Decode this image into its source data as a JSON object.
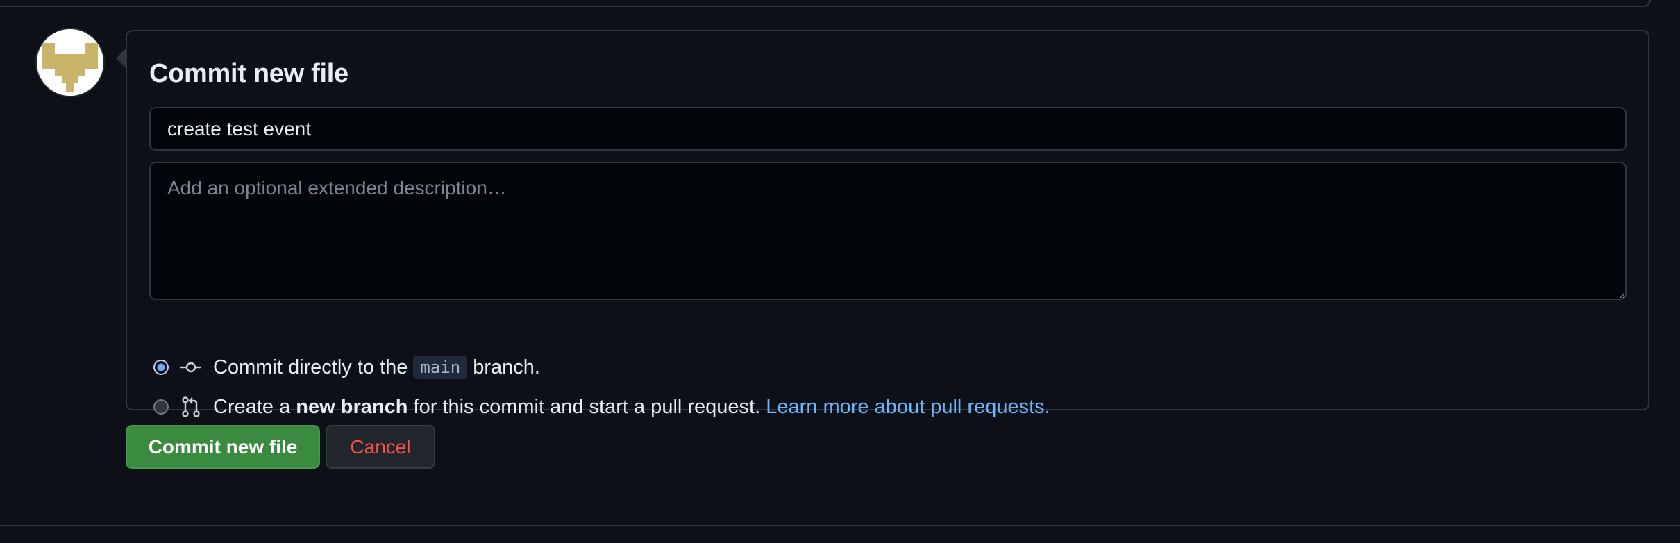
{
  "commit": {
    "title": "Commit new file",
    "summary_value": "create test event",
    "description_placeholder": "Add an optional extended description…",
    "option_direct": {
      "prefix": "Commit directly to the",
      "branch": "main",
      "suffix": "branch.",
      "selected": true,
      "icon": "git-commit-icon"
    },
    "option_new_branch": {
      "prefix": "Create a",
      "bold": "new branch",
      "suffix": "for this commit and start a pull request.",
      "link": "Learn more about pull requests.",
      "selected": false,
      "icon": "git-pull-request-icon"
    }
  },
  "actions": {
    "commit_label": "Commit new file",
    "cancel_label": "Cancel"
  },
  "colors": {
    "background": "#0d1117",
    "primary_button": "#3a8b3f",
    "danger_text": "#f85149",
    "link": "#6cb6ff",
    "avatar_identicon": "#c9b56a"
  },
  "avatar": {
    "icon": "identicon-avatar"
  }
}
